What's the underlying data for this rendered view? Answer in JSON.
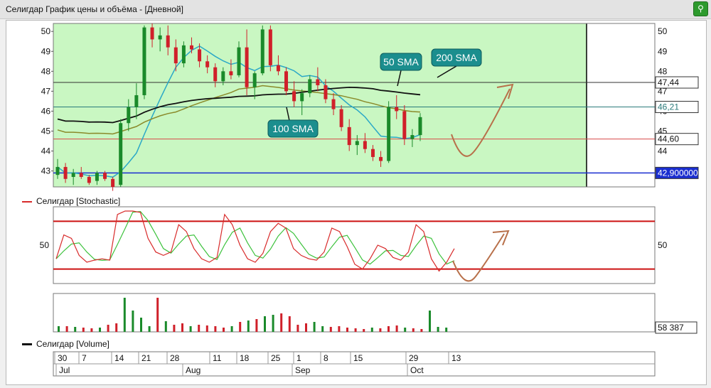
{
  "window": {
    "title": "Селигдар График цены и объёма - [Дневной]",
    "pin_icon": "pin-icon"
  },
  "colors": {
    "plot_bg": "#c9f7c2",
    "up": "#1a8a2a",
    "down": "#d0202a",
    "sma50": "#2aa8c7",
    "sma100": "#8a8a2a",
    "sma200": "#111111",
    "stoch_k": "#d82a2a",
    "stoch_d": "#3cc23c",
    "level_line": "#cc1111",
    "support": "#1a2ed0",
    "callout": "#1b8e8e",
    "arrow": "#b8704a"
  },
  "price_panel": {
    "y_ticks": [
      "50",
      "49",
      "48",
      "47",
      "46",
      "45",
      "44",
      "43"
    ],
    "right_tags": [
      "47,44",
      "46,21",
      "44,60",
      "42,900000"
    ],
    "annotations": [
      "50 SMA",
      "200 SMA",
      "100 SMA"
    ]
  },
  "stoch_panel": {
    "legend": "Селигдар [Stochastic]",
    "y_label_left": "50",
    "y_label_right": "50"
  },
  "volume_panel": {
    "legend": "Селигдар [Volume]",
    "last_value": "58 387"
  },
  "time_axis": {
    "day_ticks": [
      "30",
      "7",
      "14",
      "21",
      "28",
      "11",
      "18",
      "25",
      "1",
      "8",
      "15",
      "29",
      "13"
    ],
    "month_ticks": [
      "Jul",
      "Aug",
      "Sep",
      "Oct"
    ]
  },
  "chart_data": {
    "type": "line",
    "series": [
      {
        "name": "Селигдар [Stochastic]",
        "values": [
          30,
          65,
          60,
          35,
          25,
          28,
          30,
          28,
          95,
          100,
          100,
          98,
          60,
          40,
          35,
          40,
          80,
          70,
          45,
          30,
          25,
          32,
          95,
          80,
          50,
          30,
          25,
          38,
          70,
          82,
          75,
          45,
          35,
          30,
          28,
          40,
          75,
          70,
          48,
          22,
          15,
          30,
          50,
          45,
          32,
          28,
          40,
          80,
          70,
          30,
          12,
          25,
          45
        ]
      },
      {
        "name": "Селигдар [Volume]",
        "values": [
          8,
          8,
          7,
          6,
          5,
          6,
          10,
          12,
          48,
          30,
          20,
          8,
          48,
          15,
          10,
          12,
          8,
          10,
          9,
          8,
          6,
          8,
          14,
          16,
          18,
          22,
          24,
          26,
          22,
          10,
          12,
          14,
          8,
          7,
          8,
          6,
          5,
          4,
          6,
          5,
          8,
          9,
          6,
          5,
          4,
          30,
          7,
          6
        ]
      }
    ],
    "price": {
      "ylim": [
        42.2,
        50.4
      ],
      "levels": [
        47.44,
        46.21,
        44.6,
        42.9
      ],
      "candles": [
        [
          42.8,
          43.6,
          42.6,
          43.2
        ],
        [
          43.2,
          43.4,
          42.4,
          42.6
        ],
        [
          42.7,
          43.1,
          42.3,
          42.9
        ],
        [
          42.9,
          43.2,
          42.6,
          42.7
        ],
        [
          42.7,
          42.8,
          42.3,
          42.4
        ],
        [
          42.5,
          43.0,
          42.3,
          42.9
        ],
        [
          42.9,
          43.0,
          42.5,
          42.6
        ],
        [
          42.6,
          42.7,
          42.0,
          42.2
        ],
        [
          42.3,
          45.6,
          42.2,
          45.4
        ],
        [
          45.4,
          46.6,
          45.0,
          46.2
        ],
        [
          46.2,
          47.4,
          45.6,
          46.8
        ],
        [
          46.8,
          50.3,
          46.6,
          50.2
        ],
        [
          50.2,
          50.4,
          49.2,
          49.6
        ],
        [
          49.6,
          50.2,
          49.0,
          49.8
        ],
        [
          49.8,
          50.3,
          48.8,
          49.2
        ],
        [
          49.2,
          49.6,
          48.0,
          48.4
        ],
        [
          48.4,
          49.5,
          48.2,
          49.3
        ],
        [
          49.3,
          49.7,
          48.9,
          49.1
        ],
        [
          49.1,
          49.4,
          48.2,
          48.5
        ],
        [
          48.5,
          48.8,
          47.9,
          48.2
        ],
        [
          48.2,
          48.4,
          47.2,
          47.5
        ],
        [
          47.5,
          48.2,
          47.3,
          48.0
        ],
        [
          48.0,
          48.6,
          47.6,
          47.8
        ],
        [
          47.8,
          49.5,
          47.7,
          49.2
        ],
        [
          49.2,
          50.1,
          46.8,
          47.2
        ],
        [
          47.2,
          48.0,
          46.6,
          47.9
        ],
        [
          47.9,
          50.3,
          47.8,
          50.1
        ],
        [
          50.1,
          50.3,
          48.0,
          48.3
        ],
        [
          48.3,
          48.8,
          47.8,
          48.0
        ],
        [
          48.0,
          48.2,
          46.8,
          47.0
        ],
        [
          47.0,
          47.5,
          46.2,
          46.5
        ],
        [
          46.5,
          47.1,
          45.8,
          46.9
        ],
        [
          46.9,
          47.8,
          46.7,
          47.6
        ],
        [
          47.6,
          48.2,
          47.0,
          47.3
        ],
        [
          47.3,
          47.6,
          46.4,
          46.6
        ],
        [
          46.6,
          46.9,
          45.8,
          46.1
        ],
        [
          46.1,
          46.3,
          45.0,
          45.2
        ],
        [
          45.2,
          45.6,
          44.0,
          44.3
        ],
        [
          44.3,
          44.8,
          43.8,
          44.5
        ],
        [
          44.5,
          44.9,
          43.9,
          44.1
        ],
        [
          44.1,
          44.3,
          43.5,
          43.7
        ],
        [
          43.7,
          44.0,
          43.2,
          43.5
        ],
        [
          43.5,
          46.5,
          43.4,
          46.2
        ],
        [
          46.2,
          46.8,
          45.6,
          46.0
        ],
        [
          46.0,
          46.3,
          44.3,
          44.6
        ],
        [
          44.6,
          45.1,
          44.2,
          44.8
        ],
        [
          44.8,
          45.9,
          44.5,
          45.7
        ]
      ]
    }
  }
}
